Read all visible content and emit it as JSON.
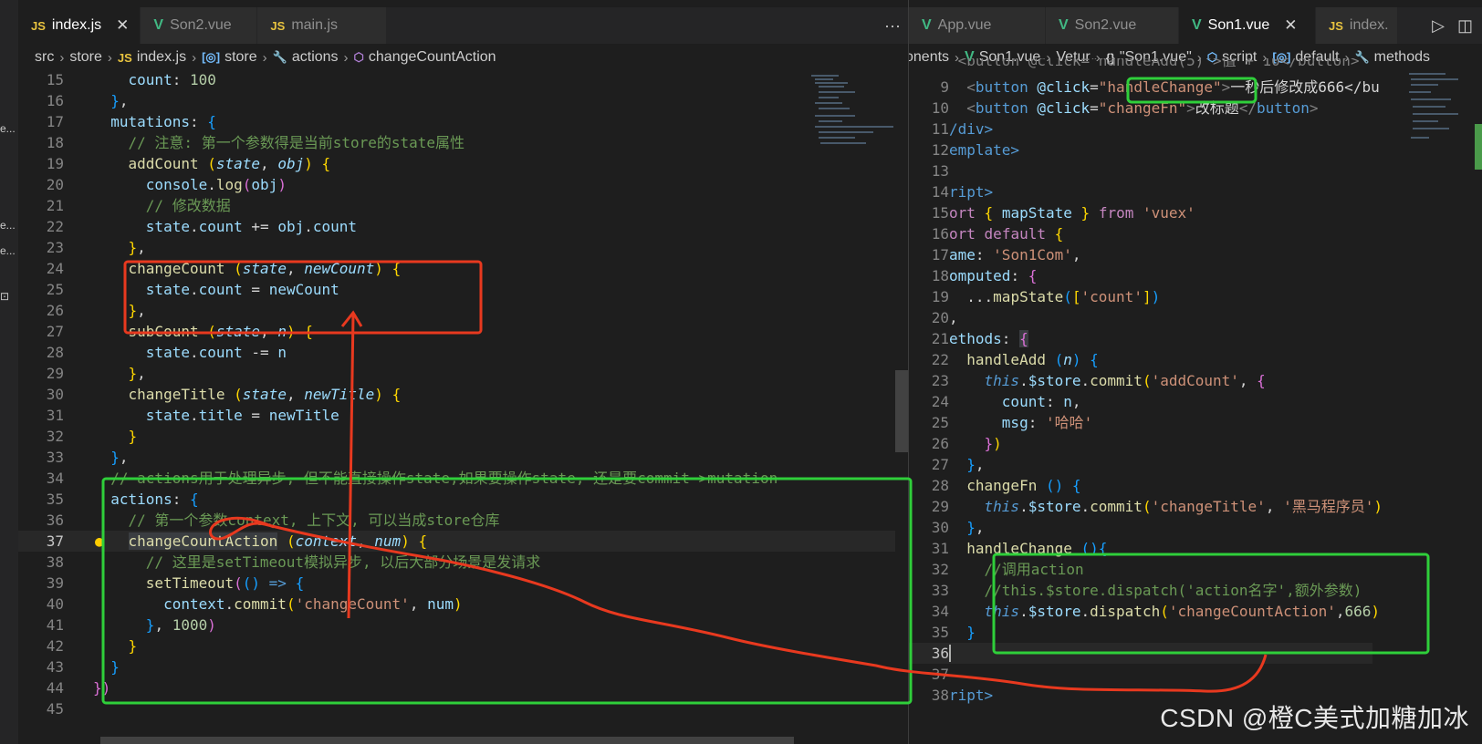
{
  "activity_bar": {
    "fragments": [
      "e...",
      "e...",
      "e...",
      "⊡"
    ]
  },
  "left_editor": {
    "tabs": [
      {
        "icon": "JS",
        "label": "index.js",
        "close": "✕",
        "active": true
      },
      {
        "icon": "V",
        "label": "Son2.vue",
        "close": "",
        "active": false
      },
      {
        "icon": "JS",
        "label": "main.js",
        "close": "",
        "active": false
      }
    ],
    "more_actions": "···",
    "breadcrumb": [
      {
        "icon": "",
        "label": "src"
      },
      {
        "icon": "",
        "label": "store"
      },
      {
        "icon": "JS",
        "label": "index.js"
      },
      {
        "icon": "[◎]",
        "label": "store"
      },
      {
        "icon": "🔧",
        "label": "actions"
      },
      {
        "icon": "⬡",
        "label": "changeCountAction"
      }
    ],
    "line_numbers": [
      "15",
      "16",
      "17",
      "18",
      "19",
      "20",
      "21",
      "22",
      "23",
      "24",
      "25",
      "26",
      "27",
      "28",
      "29",
      "30",
      "31",
      "32",
      "33",
      "34",
      "35",
      "36",
      "37",
      "38",
      "39",
      "40",
      "41",
      "42",
      "43",
      "44",
      "45"
    ],
    "current_line": "37",
    "t": {
      "count_key": "count",
      "count_val": "100",
      "mutations": "mutations",
      "c18": "// 注意: 第一个参数得是当前store的state属性",
      "addCount": "addCount",
      "state": "state",
      "obj": "obj",
      "console": "console",
      "log": "log",
      "c21": "// 修改数据",
      "l22_a": "state",
      "l22_b": "count",
      "l22_c": "obj",
      "l22_d": "count",
      "changeCount": "changeCount",
      "newCount": "newCount",
      "subCount": "subCount",
      "n": "n",
      "changeTitle": "changeTitle",
      "newTitle": "newTitle",
      "title": "title",
      "c34": "// actions用于处理异步, 但不能直接操作state,如果要操作state, 还是要commit->mutation",
      "actions": "actions",
      "c36": "// 第一个参数context, 上下文, 可以当成store仓库",
      "changeCountAction": "changeCountAction",
      "context": "context",
      "num": "num",
      "c38": "// 这里是setTimeout模拟异步, 以后大部分场景是发请求",
      "setTimeout": "setTimeout",
      "commit": "commit",
      "str_changeCount": "'changeCount'",
      "delay": "1000"
    }
  },
  "right_editor": {
    "tabs": [
      {
        "icon": "V",
        "label": "App.vue",
        "close": "",
        "active": false
      },
      {
        "icon": "V",
        "label": "Son2.vue",
        "close": "",
        "active": false
      },
      {
        "icon": "V",
        "label": "Son1.vue",
        "close": "✕",
        "active": true
      },
      {
        "icon": "JS",
        "label": "index.",
        "close": "",
        "active": false
      }
    ],
    "tab_actions": [
      "▷",
      "◫"
    ],
    "breadcrumb": [
      {
        "icon": "",
        "label": "onents"
      },
      {
        "icon": "V",
        "label": "Son1.vue"
      },
      {
        "icon": "",
        "label": "Vetur"
      },
      {
        "icon": "{}",
        "label": "\"Son1.vue\""
      },
      {
        "icon": "⬡",
        "label": "script"
      },
      {
        "icon": "[◎]",
        "label": "default"
      },
      {
        "icon": "🔧",
        "label": "methods"
      }
    ],
    "line_numbers": [
      "9",
      "10",
      "11",
      "12",
      "13",
      "14",
      "15",
      "16",
      "17",
      "18",
      "19",
      "20",
      "21",
      "22",
      "23",
      "24",
      "25",
      "26",
      "27",
      "28",
      "29",
      "30",
      "31",
      "32",
      "33",
      "34",
      "35",
      "36",
      "37",
      "38"
    ],
    "current_line": "36",
    "t": {
      "l8_partial": "<button @click=\"handleAdd(5)\">值 + 10</button>",
      "button": "button",
      "click": "@click",
      "handleChange_str": "\"handleChange\"",
      "l9_text": "一秒后修改成666</bu",
      "changeFn_str": "\"changeFn\"",
      "l10_text": "改标题",
      "l11": "/div>",
      "l12": "emplate>",
      "l14": "ript>",
      "l15_a": "ort",
      "mapState": "mapState",
      "from": "from",
      "vuex": "'vuex'",
      "l16_a": "ort",
      "default": "default",
      "l17_a": "ame",
      "son1com": "'Son1Com'",
      "l18_a": "omputed",
      "spread": "...",
      "count_arr": "'count'",
      "l21_a": "ethods",
      "handleAdd": "handleAdd",
      "n": "n",
      "this": "this",
      "store": "$store",
      "commit": "commit",
      "addCount_str": "'addCount'",
      "count_key": "count",
      "msg_key": "msg",
      "haha": "'哈哈'",
      "changeFn": "changeFn",
      "changeTitle_str": "'changeTitle'",
      "heima": "'黑马程序员'",
      "handleChange": "handleChange",
      "c32": "//调用action",
      "c33": "//this.$store.dispatch('action名字',额外参数)",
      "dispatch": "dispatch",
      "cca_str": "'changeCountAction'",
      "v666": "666",
      "l38": "ript>"
    }
  },
  "watermark": "CSDN @橙C美式加糖加冰",
  "annotations": {
    "red": "#e8391f",
    "green": "#2fcf3a"
  }
}
